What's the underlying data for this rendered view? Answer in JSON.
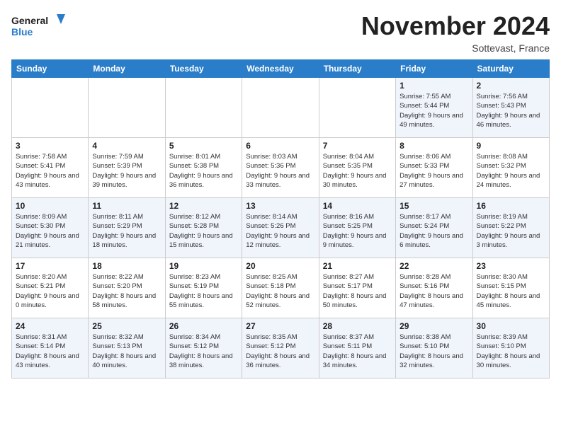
{
  "logo": {
    "line1": "General",
    "line2": "Blue"
  },
  "title": "November 2024",
  "location": "Sottevast, France",
  "days_of_week": [
    "Sunday",
    "Monday",
    "Tuesday",
    "Wednesday",
    "Thursday",
    "Friday",
    "Saturday"
  ],
  "weeks": [
    [
      {
        "day": "",
        "info": ""
      },
      {
        "day": "",
        "info": ""
      },
      {
        "day": "",
        "info": ""
      },
      {
        "day": "",
        "info": ""
      },
      {
        "day": "",
        "info": ""
      },
      {
        "day": "1",
        "info": "Sunrise: 7:55 AM\nSunset: 5:44 PM\nDaylight: 9 hours and 49 minutes."
      },
      {
        "day": "2",
        "info": "Sunrise: 7:56 AM\nSunset: 5:43 PM\nDaylight: 9 hours and 46 minutes."
      }
    ],
    [
      {
        "day": "3",
        "info": "Sunrise: 7:58 AM\nSunset: 5:41 PM\nDaylight: 9 hours and 43 minutes."
      },
      {
        "day": "4",
        "info": "Sunrise: 7:59 AM\nSunset: 5:39 PM\nDaylight: 9 hours and 39 minutes."
      },
      {
        "day": "5",
        "info": "Sunrise: 8:01 AM\nSunset: 5:38 PM\nDaylight: 9 hours and 36 minutes."
      },
      {
        "day": "6",
        "info": "Sunrise: 8:03 AM\nSunset: 5:36 PM\nDaylight: 9 hours and 33 minutes."
      },
      {
        "day": "7",
        "info": "Sunrise: 8:04 AM\nSunset: 5:35 PM\nDaylight: 9 hours and 30 minutes."
      },
      {
        "day": "8",
        "info": "Sunrise: 8:06 AM\nSunset: 5:33 PM\nDaylight: 9 hours and 27 minutes."
      },
      {
        "day": "9",
        "info": "Sunrise: 8:08 AM\nSunset: 5:32 PM\nDaylight: 9 hours and 24 minutes."
      }
    ],
    [
      {
        "day": "10",
        "info": "Sunrise: 8:09 AM\nSunset: 5:30 PM\nDaylight: 9 hours and 21 minutes."
      },
      {
        "day": "11",
        "info": "Sunrise: 8:11 AM\nSunset: 5:29 PM\nDaylight: 9 hours and 18 minutes."
      },
      {
        "day": "12",
        "info": "Sunrise: 8:12 AM\nSunset: 5:28 PM\nDaylight: 9 hours and 15 minutes."
      },
      {
        "day": "13",
        "info": "Sunrise: 8:14 AM\nSunset: 5:26 PM\nDaylight: 9 hours and 12 minutes."
      },
      {
        "day": "14",
        "info": "Sunrise: 8:16 AM\nSunset: 5:25 PM\nDaylight: 9 hours and 9 minutes."
      },
      {
        "day": "15",
        "info": "Sunrise: 8:17 AM\nSunset: 5:24 PM\nDaylight: 9 hours and 6 minutes."
      },
      {
        "day": "16",
        "info": "Sunrise: 8:19 AM\nSunset: 5:22 PM\nDaylight: 9 hours and 3 minutes."
      }
    ],
    [
      {
        "day": "17",
        "info": "Sunrise: 8:20 AM\nSunset: 5:21 PM\nDaylight: 9 hours and 0 minutes."
      },
      {
        "day": "18",
        "info": "Sunrise: 8:22 AM\nSunset: 5:20 PM\nDaylight: 8 hours and 58 minutes."
      },
      {
        "day": "19",
        "info": "Sunrise: 8:23 AM\nSunset: 5:19 PM\nDaylight: 8 hours and 55 minutes."
      },
      {
        "day": "20",
        "info": "Sunrise: 8:25 AM\nSunset: 5:18 PM\nDaylight: 8 hours and 52 minutes."
      },
      {
        "day": "21",
        "info": "Sunrise: 8:27 AM\nSunset: 5:17 PM\nDaylight: 8 hours and 50 minutes."
      },
      {
        "day": "22",
        "info": "Sunrise: 8:28 AM\nSunset: 5:16 PM\nDaylight: 8 hours and 47 minutes."
      },
      {
        "day": "23",
        "info": "Sunrise: 8:30 AM\nSunset: 5:15 PM\nDaylight: 8 hours and 45 minutes."
      }
    ],
    [
      {
        "day": "24",
        "info": "Sunrise: 8:31 AM\nSunset: 5:14 PM\nDaylight: 8 hours and 43 minutes."
      },
      {
        "day": "25",
        "info": "Sunrise: 8:32 AM\nSunset: 5:13 PM\nDaylight: 8 hours and 40 minutes."
      },
      {
        "day": "26",
        "info": "Sunrise: 8:34 AM\nSunset: 5:12 PM\nDaylight: 8 hours and 38 minutes."
      },
      {
        "day": "27",
        "info": "Sunrise: 8:35 AM\nSunset: 5:12 PM\nDaylight: 8 hours and 36 minutes."
      },
      {
        "day": "28",
        "info": "Sunrise: 8:37 AM\nSunset: 5:11 PM\nDaylight: 8 hours and 34 minutes."
      },
      {
        "day": "29",
        "info": "Sunrise: 8:38 AM\nSunset: 5:10 PM\nDaylight: 8 hours and 32 minutes."
      },
      {
        "day": "30",
        "info": "Sunrise: 8:39 AM\nSunset: 5:10 PM\nDaylight: 8 hours and 30 minutes."
      }
    ]
  ]
}
